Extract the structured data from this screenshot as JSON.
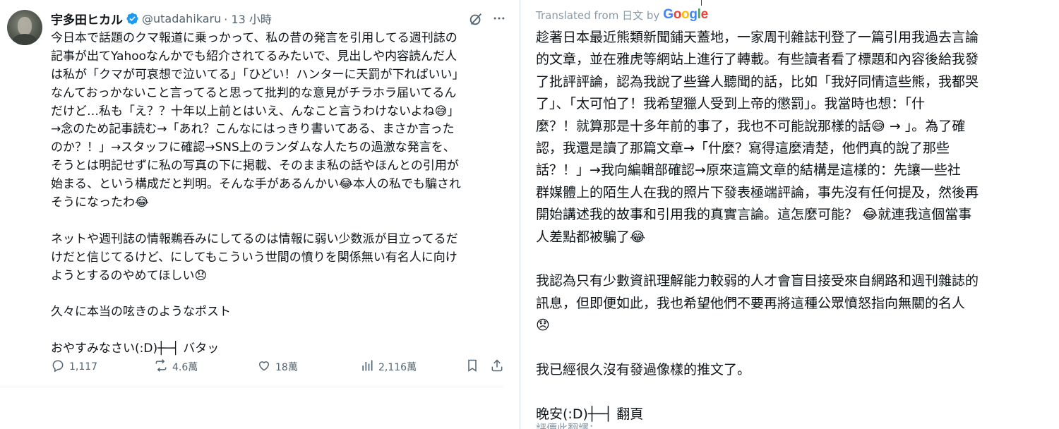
{
  "tweet": {
    "display_name": "宇多田ヒカル",
    "handle": "@utadahikaru",
    "time": "· 13 小時",
    "lines": [
      "今日本で話題のクマ報道に乗っかって、私の昔の発言を引用してる週刊誌の",
      "記事が出てYahooなんかでも紹介されてるみたいで、見出しや内容読んだ人",
      "は私が「クマが可哀想で泣いてる」「ひどい！ハンターに天罰が下ればいい」",
      "なんておっかないこと言ってると思って批判的な意見がチラホラ届いてるん",
      "だけど…私も「え？？十年以上前とはいえ、んなこと言うわけないよね😅」",
      "→念のため記事読む→「あれ？こんなにはっきり書いてある、まさか言った",
      "のか？！」→スタッフに確認→SNS上のランダムな人たちの過激な発言を、",
      "そうとは明記せずに私の写真の下に掲載、そのまま私の話やほんとの引用が",
      "始まる、という構成だと判明。そんな手があるんかい😂本人の私でも騙され",
      "そうになったわ😂",
      "",
      "ネットや週刊誌の情報鵜呑みにしてるのは情報に弱い少数派が目立ってるだ",
      "けだと信じてるけど、にしてもこういう世間の憤りを関係無い有名人に向け",
      "ようとするのやめてほしい😞",
      "",
      "久々に本当の呟きのようなポスト",
      "",
      "おやすみなさい(:D)┼─┤ バタッ"
    ],
    "stats": {
      "replies": "1,117",
      "reposts": "4.6萬",
      "likes": "18萬",
      "views": "2,116萬"
    }
  },
  "translation": {
    "translated_from": "Translated from 日文 by",
    "google_logo": "Google",
    "lines": [
      "趁著日本最近熊類新聞鋪天蓋地，一家周刊雜誌刊登了一篇引用我過去言論",
      "的文章，並在雅虎等網站上進行了轉載。有些讀者看了標題和內容後給我發",
      "了批評評論，認為我說了些聳人聽聞的話，比如「我好同情這些熊，我都哭",
      "了」、「太可怕了！我希望獵人受到上帝的懲罰」。我當時也想：「什",
      "麼？！就算那是十多年前的事了，我也不可能說那樣的話😅 → 」。為了確",
      "認，我還是讀了那篇文章→「什麼？寫得這麼清楚，他們真的說了那些",
      "話？！」→我向編輯部確認→原來這篇文章的結構是這樣的：先讓一些社",
      "群媒體上的陌生人在我的照片下發表極端評論，事先沒有任何提及，然後再",
      "開始講述我的故事和引用我的真實言論。這怎麼可能？ 😂就連我這個當事",
      "人差點都被騙了😂",
      "",
      "我認為只有少數資訊理解能力較弱的人才會盲目接受來自網路和週刊雜誌的",
      "訊息，但即便如此，我也希望他們不要再將這種公眾憤怒指向無關的名人",
      "😞",
      "",
      "我已經很久沒有發過像樣的推文了。",
      "",
      "晚安(:D)┼─┤ 翻頁"
    ],
    "rate_label": "評價此翻譯："
  },
  "colors": {
    "text": "#0f1419",
    "secondary": "#536471",
    "verified": "#1d9bf0",
    "divider": "#eff3f4"
  },
  "icons": [
    "verified-badge-icon",
    "grok-icon",
    "more-icon",
    "reply-icon",
    "repost-icon",
    "like-icon",
    "views-icon",
    "bookmark-icon",
    "share-icon"
  ]
}
